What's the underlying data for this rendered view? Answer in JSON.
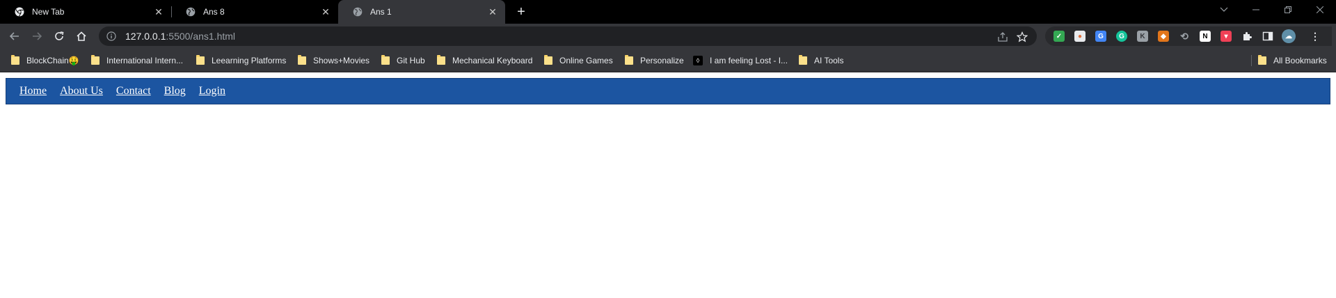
{
  "browser": {
    "tabs": [
      {
        "title": "New Tab",
        "icon": "chrome-icon",
        "active": false
      },
      {
        "title": "Ans 8",
        "icon": "globe-icon",
        "active": false
      },
      {
        "title": "Ans 1",
        "icon": "globe-icon",
        "active": true
      }
    ],
    "address": {
      "host": "127.0.0.1",
      "rest": ":5500/ans1.html"
    },
    "bookmarks": [
      {
        "label": "BlockChain🤑"
      },
      {
        "label": "International Intern..."
      },
      {
        "label": "Leearning Platforms"
      },
      {
        "label": "Shows+Movies"
      },
      {
        "label": "Git Hub"
      },
      {
        "label": "Mechanical Keyboard"
      },
      {
        "label": "Online Games"
      },
      {
        "label": "Personalize"
      },
      {
        "label": "I am feeling Lost - I..."
      },
      {
        "label": "AI Tools"
      }
    ],
    "all_bookmarks_label": "All Bookmarks"
  },
  "site": {
    "nav": [
      "Home",
      "About Us",
      "Contact",
      "Blog",
      "Login"
    ]
  },
  "colors": {
    "nav_bg": "#1c55a1",
    "browser_dark": "#35363a"
  }
}
